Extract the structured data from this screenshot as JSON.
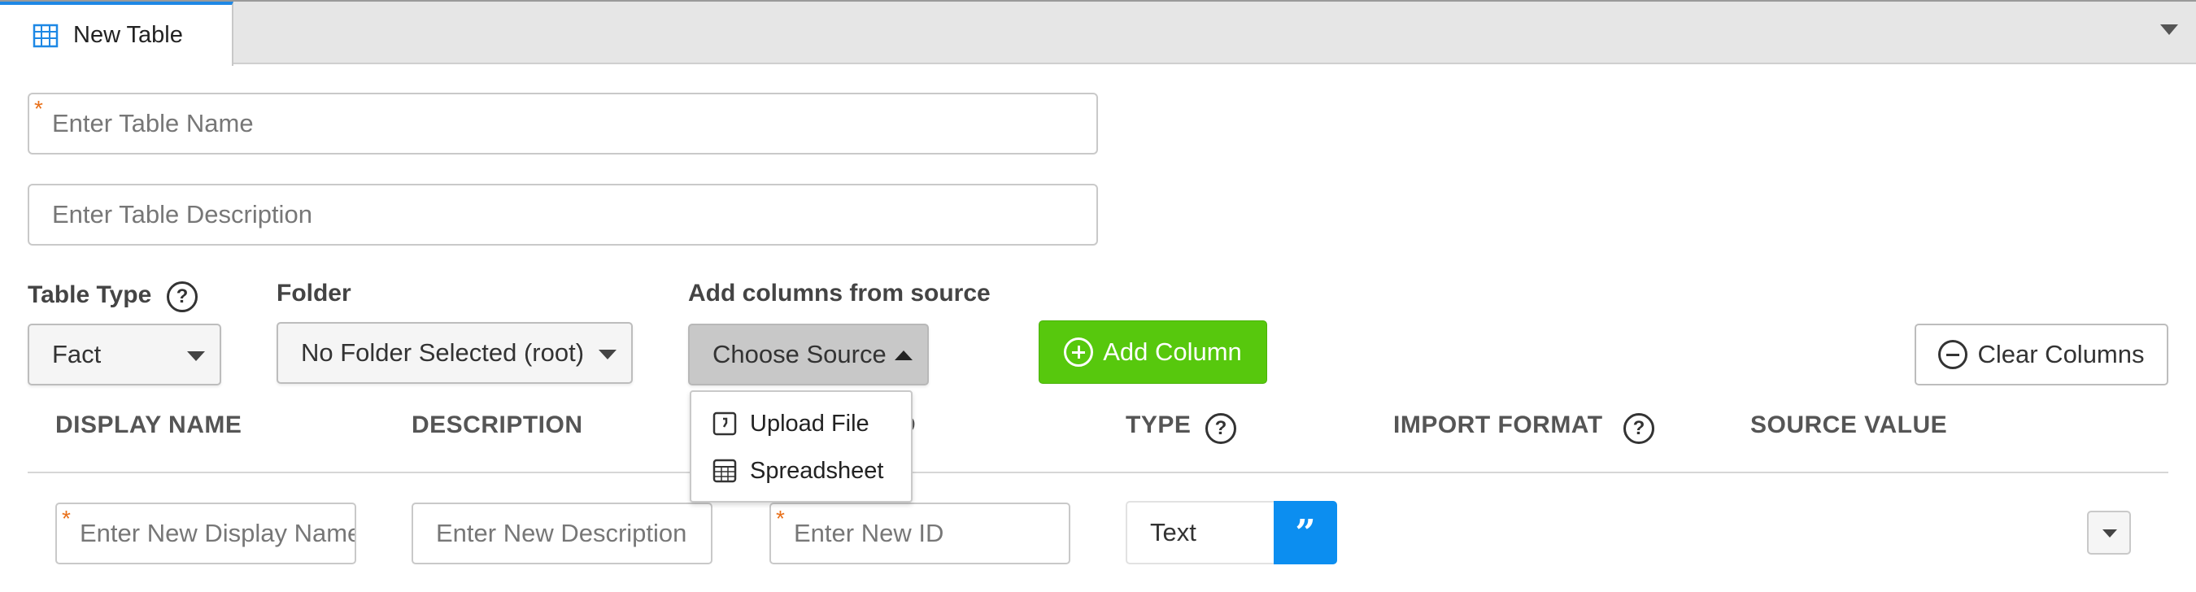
{
  "tab": {
    "label": "New Table"
  },
  "form": {
    "name_placeholder": "Enter Table Name",
    "description_placeholder": "Enter Table Description",
    "required_mark": "*"
  },
  "table_type": {
    "label": "Table Type",
    "value": "Fact",
    "help": "?"
  },
  "folder": {
    "label": "Folder",
    "value": "No Folder Selected (root)"
  },
  "source": {
    "label": "Add columns from source",
    "button": "Choose Source",
    "menu": [
      {
        "label": "Upload File",
        "icon": "upload-file-icon"
      },
      {
        "label": "Spreadsheet",
        "icon": "spreadsheet-icon"
      }
    ]
  },
  "actions": {
    "add_column": "Add Column",
    "clear_columns": "Clear Columns"
  },
  "columns": {
    "display_name": "DISPLAY NAME",
    "description": "DESCRIPTION",
    "id_suffix": "D",
    "type": "TYPE",
    "import_format": "IMPORT FORMAT",
    "source_value": "SOURCE VALUE",
    "help": "?"
  },
  "new_row": {
    "display_name_placeholder": "Enter New Display Name",
    "description_placeholder": "Enter New Description",
    "id_placeholder": "Enter New ID",
    "type_value": "Text",
    "type_button_glyph": "”"
  },
  "colors": {
    "accent_green": "#57c80d",
    "accent_blue": "#0c8ef0",
    "required_orange": "#e8701a",
    "tab_accent": "#1e88e5"
  }
}
